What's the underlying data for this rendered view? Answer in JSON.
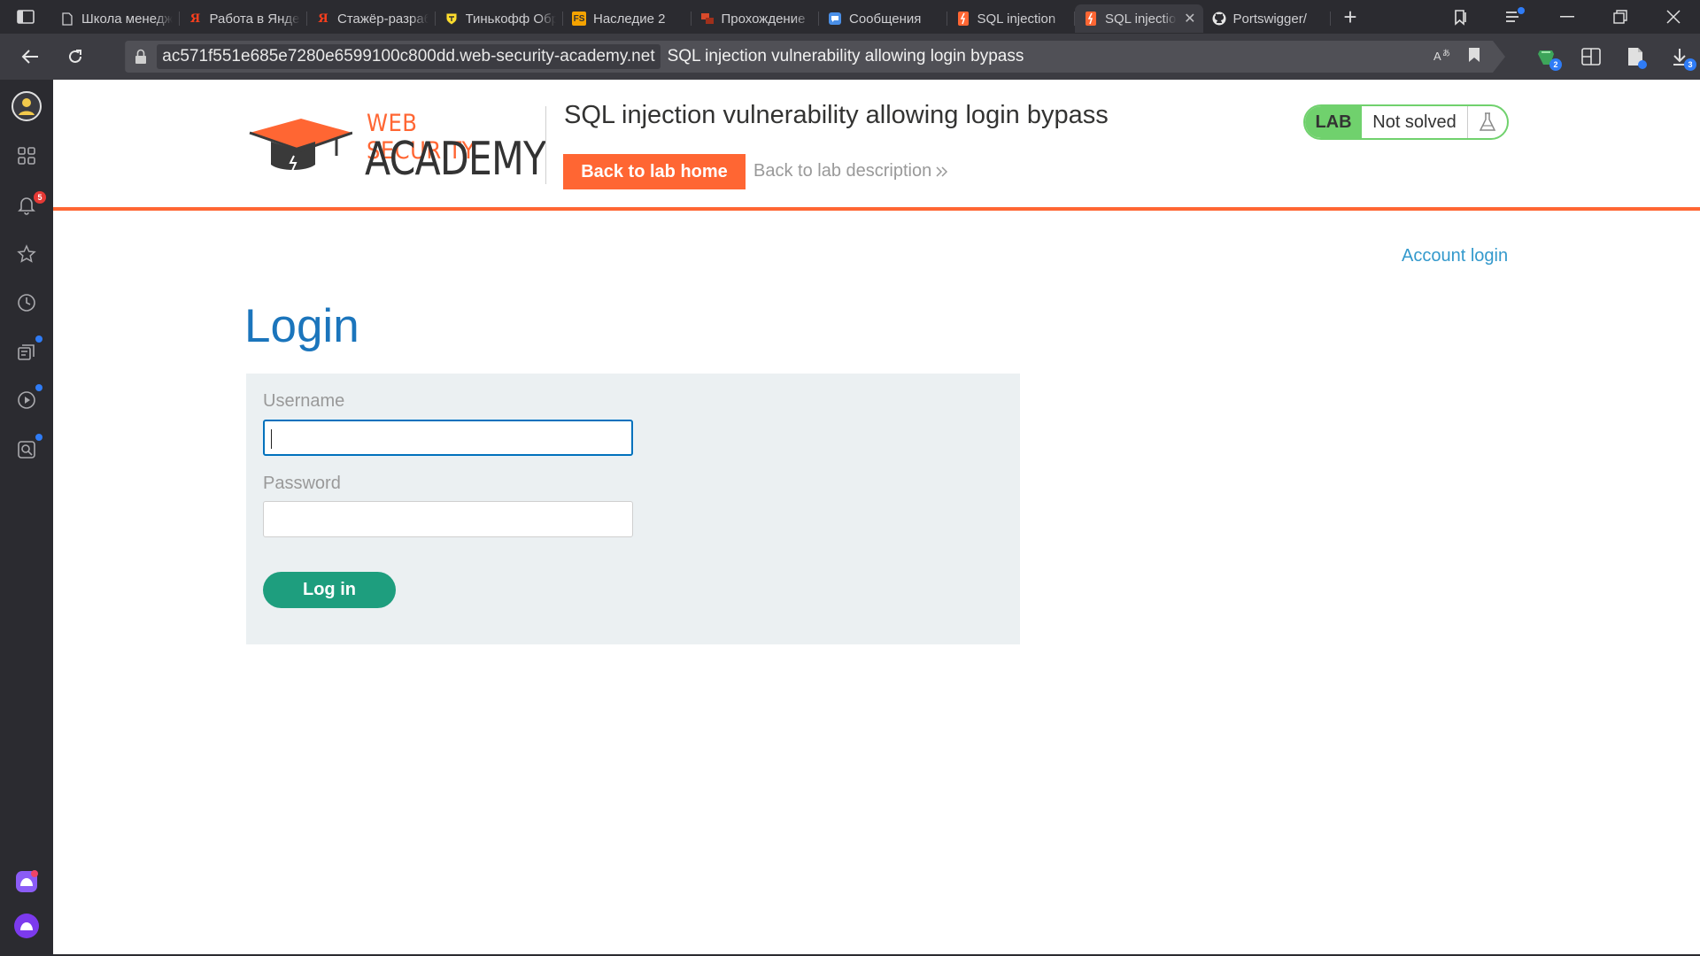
{
  "browser": {
    "tabs": [
      {
        "title": "Школа менеджеров",
        "favicon": "doc-icon",
        "active": false
      },
      {
        "title": "Работа в Яндексе",
        "favicon": "yandex-icon",
        "active": false
      },
      {
        "title": "Стажёр-разработчик",
        "favicon": "yandex-icon",
        "active": false
      },
      {
        "title": "Тинькофф Образование",
        "favicon": "tinkoff-icon",
        "active": false
      },
      {
        "title": "Наследие 2",
        "favicon": "fs-icon",
        "active": false
      },
      {
        "title": "Прохождение",
        "favicon": "game-icon",
        "active": false
      },
      {
        "title": "Сообщения",
        "favicon": "chat-icon",
        "active": false
      },
      {
        "title": "SQL injection",
        "favicon": "portswigger-icon",
        "active": false
      },
      {
        "title": "SQL injection",
        "favicon": "portswigger-icon",
        "active": true
      },
      {
        "title": "Portswigger/",
        "favicon": "github-icon",
        "active": false
      }
    ],
    "address": {
      "domain": "ac571f551e685e7280e6599100c800dd.web-security-academy.net",
      "page_title": "SQL injection vulnerability allowing login bypass"
    },
    "sidebar": {
      "notifications_badge": "5",
      "downloads_badge": "3",
      "extension_badge": "2"
    }
  },
  "lab": {
    "logo_top": "WEB SECURITY",
    "logo_bottom": "ACADEMY",
    "title": "SQL injection vulnerability allowing login bypass",
    "back_home_label": "Back to lab home",
    "back_description_label": "Back to lab description",
    "lab_tag": "LAB",
    "status": "Not solved"
  },
  "page": {
    "account_link": "Account login",
    "heading": "Login",
    "form": {
      "username_label": "Username",
      "username_value": "",
      "password_label": "Password",
      "password_value": "",
      "submit_label": "Log in"
    }
  },
  "colors": {
    "accent_orange": "#ff6633",
    "heading_blue": "#1b75bc",
    "link_blue": "#3399cc",
    "button_green": "#1e9e7e",
    "lab_green": "#70d16d"
  }
}
